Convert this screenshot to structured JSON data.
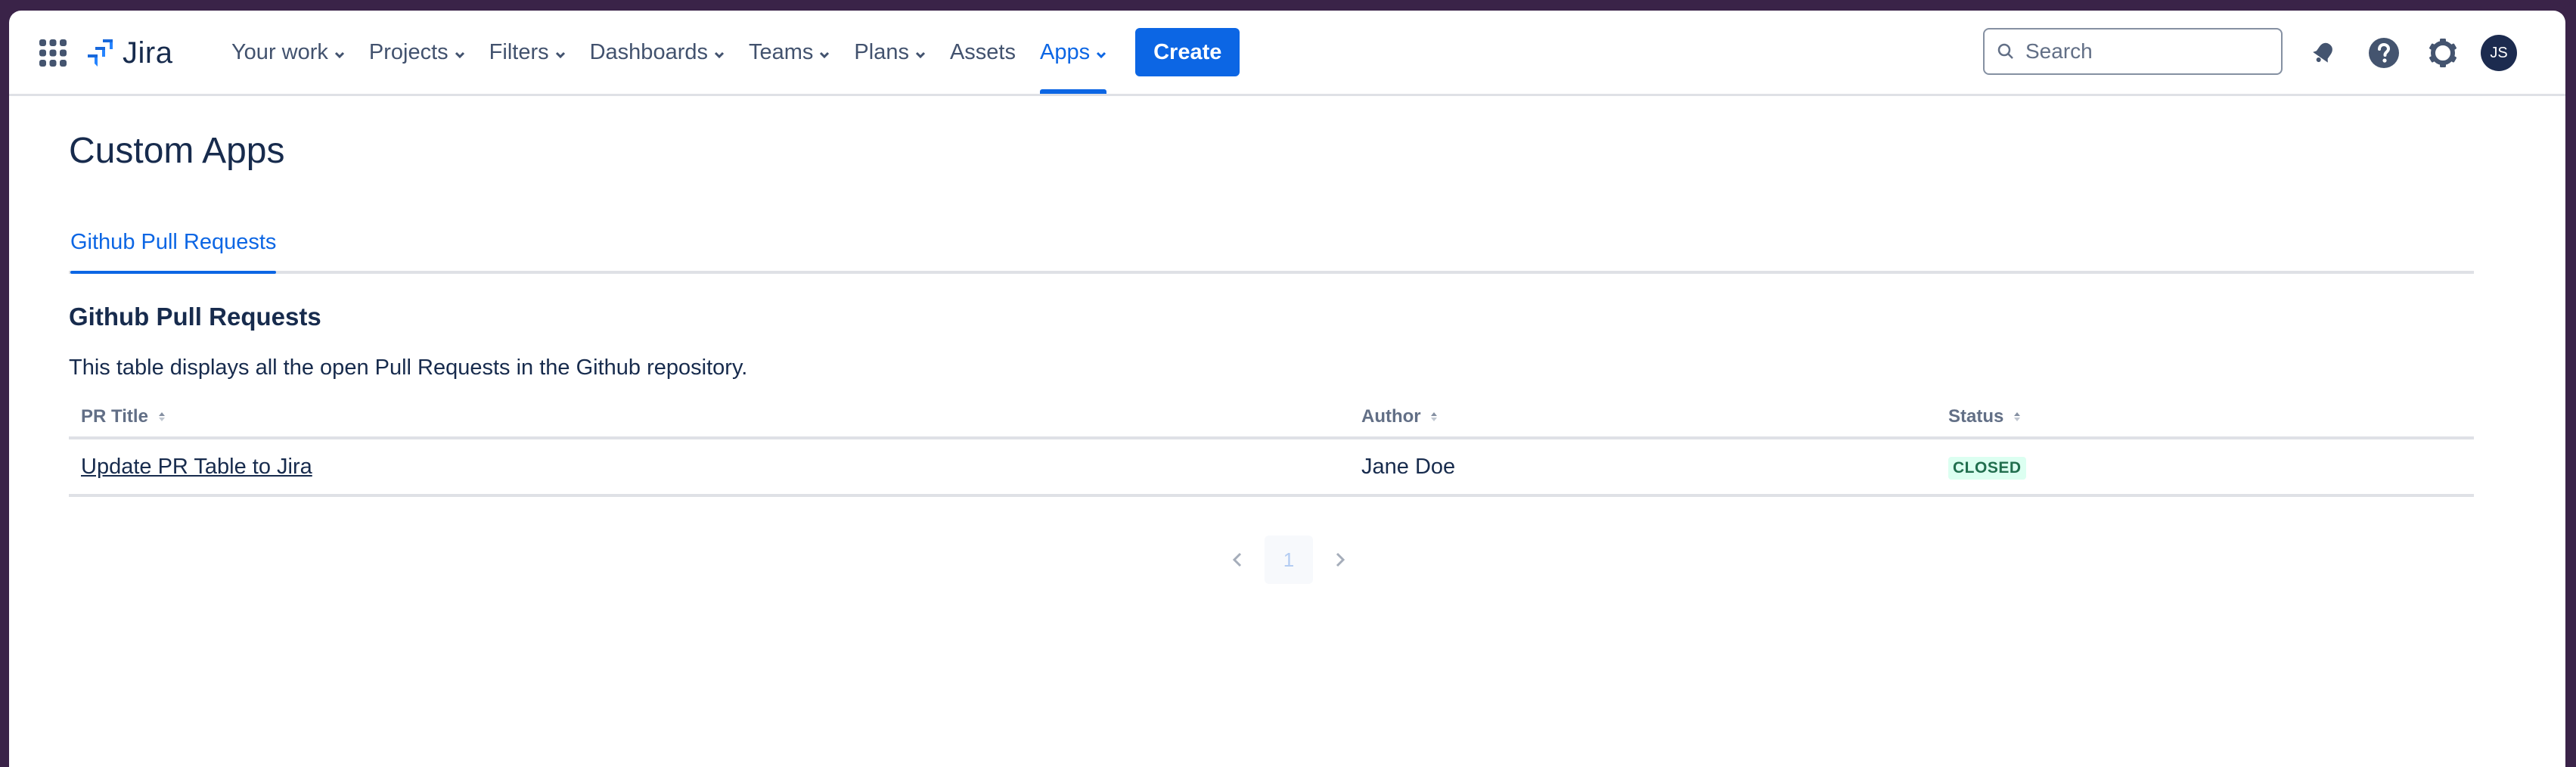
{
  "header": {
    "product_name": "Jira",
    "nav": [
      {
        "label": "Your work",
        "dropdown": true,
        "active": false
      },
      {
        "label": "Projects",
        "dropdown": true,
        "active": false
      },
      {
        "label": "Filters",
        "dropdown": true,
        "active": false
      },
      {
        "label": "Dashboards",
        "dropdown": true,
        "active": false
      },
      {
        "label": "Teams",
        "dropdown": true,
        "active": false
      },
      {
        "label": "Plans",
        "dropdown": true,
        "active": false
      },
      {
        "label": "Assets",
        "dropdown": false,
        "active": false
      },
      {
        "label": "Apps",
        "dropdown": true,
        "active": true
      }
    ],
    "create_label": "Create",
    "search_placeholder": "Search",
    "icons": [
      "app-switcher-icon",
      "notifications-icon",
      "help-icon",
      "settings-icon"
    ],
    "avatar_initials": "JS"
  },
  "page": {
    "title": "Custom Apps",
    "tabs": [
      {
        "label": "Github Pull Requests",
        "selected": true
      }
    ],
    "section_title": "Github Pull Requests",
    "description": "This table displays all the open Pull Requests in the Github repository.",
    "table": {
      "columns": [
        "PR Title",
        "Author",
        "Status"
      ],
      "rows": [
        {
          "title": "Update PR Table to Jira",
          "author": "Jane Doe",
          "status": "CLOSED"
        }
      ]
    },
    "pagination": {
      "current_page": "1"
    }
  },
  "colors": {
    "brand_blue": "#0c66e4",
    "text_primary": "#172b4d",
    "text_subtle": "#42526e",
    "status_closed_bg": "#dcfff1",
    "status_closed_text": "#216e4e",
    "frame": "#3a2348"
  }
}
